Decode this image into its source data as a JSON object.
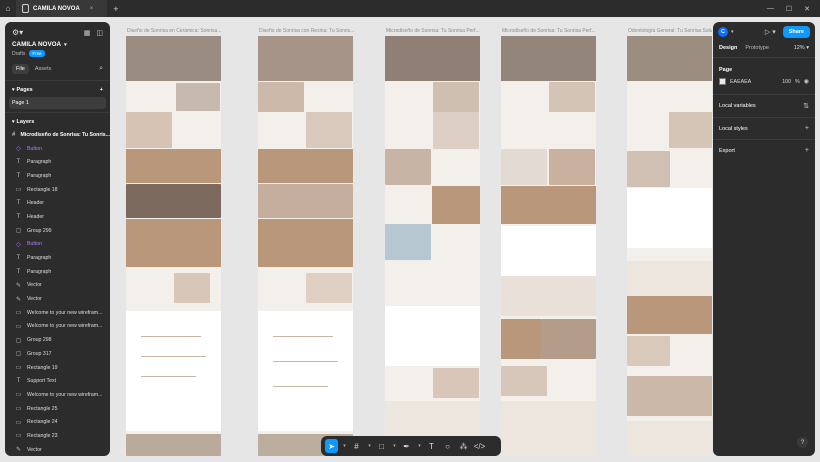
{
  "tabbar": {
    "home_icon": "home-icon",
    "file_tab": "CAMILA NOVOA",
    "close": "×",
    "new_tab": "+",
    "min": "—",
    "max": "☐",
    "close_win": "✕"
  },
  "left": {
    "project": "CAMILA NOVOA",
    "drafts": "Drafts",
    "plan": "Free",
    "tabs": {
      "file": "File",
      "assets": "Assets"
    },
    "pages_title": "Pages",
    "pages": [
      "Page 1"
    ],
    "layers_title": "Layers",
    "layers": [
      {
        "name": "Microdiseño de Sonrisa: Tu Sonris...",
        "icon": "#",
        "purple": false,
        "top": true
      },
      {
        "name": "Button",
        "icon": "◇",
        "purple": true
      },
      {
        "name": "Paragraph",
        "icon": "T",
        "purple": false
      },
      {
        "name": "Paragraph",
        "icon": "T",
        "purple": false
      },
      {
        "name": "Rectangle 18",
        "icon": "▭",
        "purple": false
      },
      {
        "name": "Header",
        "icon": "T",
        "purple": false
      },
      {
        "name": "Header",
        "icon": "T",
        "purple": false
      },
      {
        "name": "Group 299",
        "icon": "▢",
        "purple": false
      },
      {
        "name": "Button",
        "icon": "◇",
        "purple": true
      },
      {
        "name": "Paragraph",
        "icon": "T",
        "purple": false
      },
      {
        "name": "Paragraph",
        "icon": "T",
        "purple": false
      },
      {
        "name": "Vector",
        "icon": "✎",
        "purple": false
      },
      {
        "name": "Vector",
        "icon": "✎",
        "purple": false
      },
      {
        "name": "Welcome to your new wirefram...",
        "icon": "▭",
        "purple": false
      },
      {
        "name": "Welcome to your new wirefram...",
        "icon": "▭",
        "purple": false
      },
      {
        "name": "Group 298",
        "icon": "▢",
        "purple": false
      },
      {
        "name": "Group 317",
        "icon": "▢",
        "purple": false
      },
      {
        "name": "Rectangle 19",
        "icon": "▭",
        "purple": false
      },
      {
        "name": "Support Text",
        "icon": "T",
        "purple": false
      },
      {
        "name": "Welcome to your new wirefram...",
        "icon": "▭",
        "purple": false
      },
      {
        "name": "Rectangle 25",
        "icon": "▭",
        "purple": false
      },
      {
        "name": "Rectangle 24",
        "icon": "▭",
        "purple": false
      },
      {
        "name": "Rectangle 23",
        "icon": "▭",
        "purple": false
      },
      {
        "name": "Vector",
        "icon": "✎",
        "purple": false
      }
    ]
  },
  "right": {
    "avatar": "C",
    "share": "Share",
    "tabs": {
      "design": "Design",
      "prototype": "Prototype"
    },
    "zoom": "12%",
    "page_title": "Page",
    "bg_hex": "EAEAEA",
    "bg_opacity": "100",
    "pct": "%",
    "local_variables": "Local variables",
    "local_styles": "Local styles",
    "export": "Export"
  },
  "frames": [
    {
      "label": "Diseño de Sonrisa en Cerámica: Sonrisa..."
    },
    {
      "label": "Diseño de Sonrisa con Resina: Tu Sonris..."
    },
    {
      "label": "Microdiseño de Sonrisa: Tu Sonrisa Perf..."
    },
    {
      "label": "Microdiseño de Sonrisa: Tu Sonrisa Perf..."
    },
    {
      "label": "Odontología General: Tu Sonrisa Salu..."
    }
  ],
  "help": "?",
  "colors": {
    "accent": "#0d99ff",
    "tan": "#b8977a",
    "cream": "#f3f0ec",
    "purple": "#b57cf0"
  }
}
